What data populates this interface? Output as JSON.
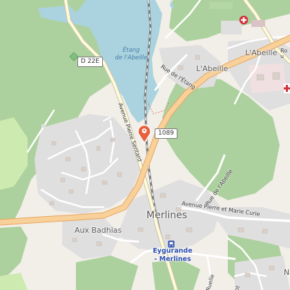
{
  "map": {
    "lake_label": "Étang\nde l'Abeille",
    "roads": {
      "d22e": "D 22E",
      "route_1089": "1089",
      "avenue_pierre_sentard": "Avenue Pierre Sentard",
      "rue_de_letang": "Rue de l'Étang",
      "rue_de_labeille": "Rue de l'Abeille",
      "avenue_curie": "Avenue Pierre et Marie Curie",
      "route_right": "Rou",
      "ruelle": "Ruelle",
      "cut_label": "ot"
    },
    "places": {
      "labeille_ne": "L'Abeille",
      "labeille": "L'Abeille",
      "merlines": "Merlines",
      "aux_badhias": "Aux Badhias",
      "edge_n": "N"
    },
    "station": {
      "name": "Eygurande\n- Merlines",
      "icon": "train-station-icon",
      "color": "#2c4fae"
    },
    "icons": {
      "selected_marker": "map-pin-marker-icon",
      "hospital": "hospital-cross-icon",
      "pharmacy": "pharmacy-cross-icon",
      "park": "park-icon"
    },
    "colors": {
      "water": "#aad3df",
      "forest": "#add19e",
      "residential": "#e0dfdf",
      "main_road": "#f7d09a",
      "road_casing": "#e8a45c",
      "marker": "#e8613c",
      "hospital_red": "#d0323a",
      "railway": "#7a7a7a"
    }
  }
}
